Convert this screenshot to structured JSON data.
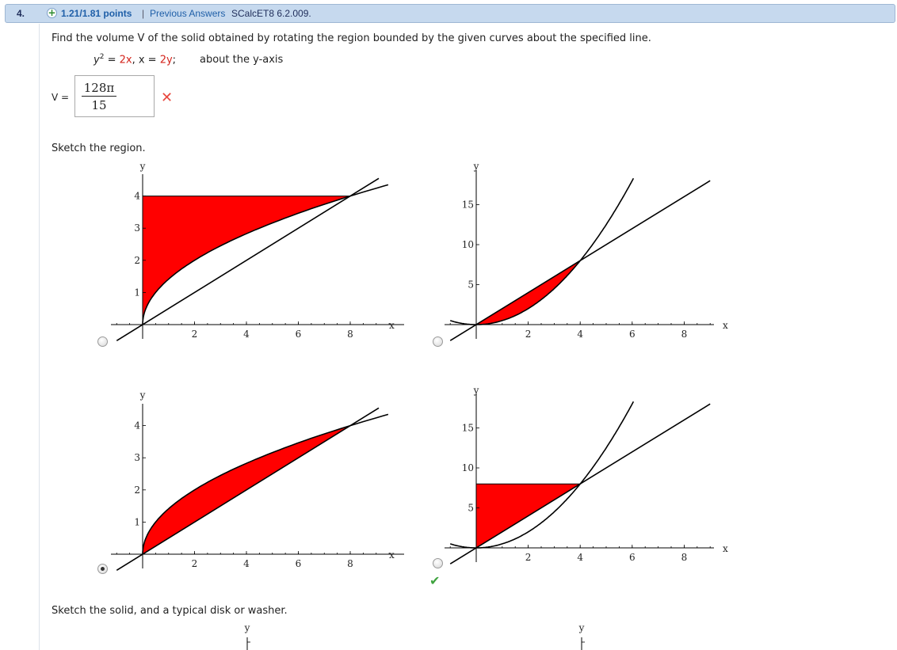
{
  "header": {
    "question_number": "4.",
    "points": "1.21/1.81 points",
    "separator": "|",
    "previous_answers": "Previous Answers",
    "source": "SCalcET8 6.2.009."
  },
  "prompt": "Find the volume V of the solid obtained by rotating the region bounded by the given curves about the specified line.",
  "equation": {
    "y2": "y",
    "sup": "2",
    "eq1": " = ",
    "rhs1": "2x",
    "comma": ", x = ",
    "rhs2": "2y",
    "semi": ";",
    "axis": "about the y-axis"
  },
  "answer": {
    "label": "V =",
    "numerator": "128π",
    "denominator": "15",
    "status_icon": "x-mark-icon",
    "status_color": "#e8473e"
  },
  "sketch_region_label": "Sketch the region.",
  "sketch_solid_label": "Sketch the solid, and a typical disk or washer.",
  "colors": {
    "fill": "#ff0000",
    "curve": "#000000"
  },
  "options": [
    {
      "id": "A",
      "selected": false,
      "correct_mark": false
    },
    {
      "id": "B",
      "selected": false,
      "correct_mark": false
    },
    {
      "id": "C",
      "selected": true,
      "correct_mark": false
    },
    {
      "id": "D",
      "selected": false,
      "correct_mark": true
    }
  ],
  "axes": {
    "x_label": "x",
    "y_label": "y",
    "small_x_ticks": [
      "2",
      "4",
      "6",
      "8"
    ],
    "small_y_ticks": [
      "1",
      "2",
      "3",
      "4"
    ],
    "big_x_ticks": [
      "2",
      "4",
      "6",
      "8"
    ],
    "big_y_ticks": [
      "5",
      "10",
      "15"
    ]
  },
  "chart_data": [
    {
      "type": "area",
      "curves": [
        "y^2 = 2x",
        "x = 2y"
      ],
      "region": "between y = sqrt(2x) and y = 4, left of curve, x from 0",
      "xlim": [
        0,
        8
      ],
      "ylim": [
        0,
        4
      ]
    },
    {
      "type": "area",
      "curves": [
        "y = x^2/2",
        "y = 2x"
      ],
      "region": "between y = 2x and y = x^2/2, x from 0 to 4",
      "xlim": [
        0,
        8
      ],
      "ylim": [
        0,
        15
      ]
    },
    {
      "type": "area",
      "curves": [
        "y = sqrt(2x)",
        "y = x/2"
      ],
      "region": "between y = sqrt(2x) and y = x/2, x from 0 to 8",
      "xlim": [
        0,
        8
      ],
      "ylim": [
        0,
        4
      ]
    },
    {
      "type": "area",
      "curves": [
        "y = x^2/2",
        "y = 2x"
      ],
      "region": "between y = 2x and y = 8, x from 0 to 4",
      "xlim": [
        0,
        8
      ],
      "ylim": [
        0,
        15
      ]
    }
  ]
}
